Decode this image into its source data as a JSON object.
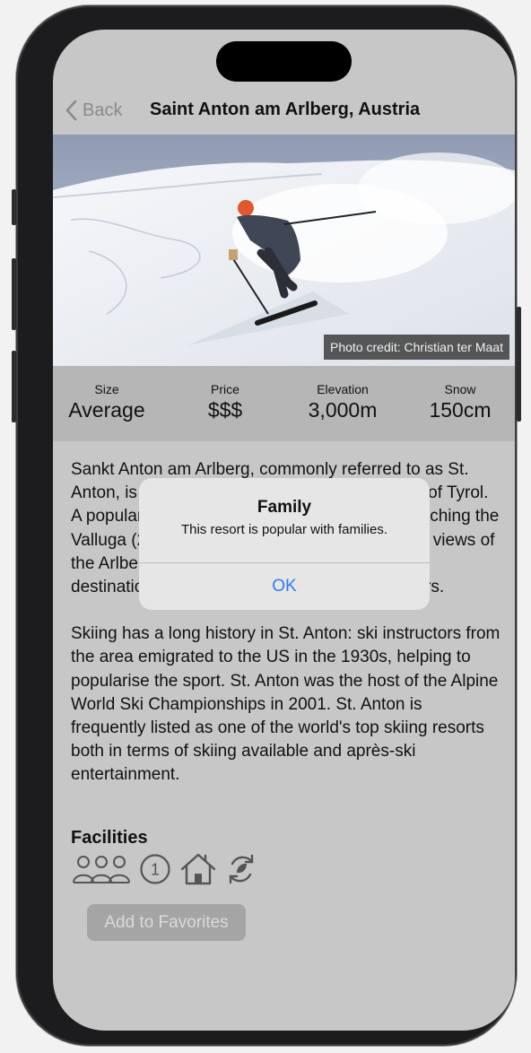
{
  "nav": {
    "back_label": "Back",
    "title": "Saint Anton am Arlberg, Austria"
  },
  "photo": {
    "credit": "Photo credit: Christian ter Maat"
  },
  "stats": [
    {
      "label": "Size",
      "value": "Average"
    },
    {
      "label": "Price",
      "value": "$$$"
    },
    {
      "label": "Elevation",
      "value": "3,000m"
    },
    {
      "label": "Snow",
      "value": "150cm"
    }
  ],
  "description": {
    "paragraph1": "Sankt Anton am Arlberg, commonly referred to as St. Anton, is a village in the western Austrian state of Tyrol. A popular winter resort with aerial tramways reaching the Valluga (2,811 m; 9,222 ft), yielding spectacular views of the Arlberg region. It is also a popular summer destination for hikers, trekkers and mountaineers.",
    "paragraph2": "Skiing has a long history in St. Anton: ski instructors from the area emigrated to the US in the 1930s, helping to popularise the sport. St. Anton was the host of the Alpine World Ski Championships in 2001. St. Anton is frequently listed as one of the world's top skiing resorts both in terms of skiing available and après-ski entertainment."
  },
  "facilities": {
    "title": "Facilities",
    "icons": [
      "family-icon",
      "one-circle-icon",
      "house-icon",
      "recycle-icon"
    ]
  },
  "favorites_button": "Add to Favorites",
  "alert": {
    "title": "Family",
    "message": "This resort is popular with families.",
    "ok_label": "OK"
  },
  "colors": {
    "accent": "#2e7cf6",
    "dimmed_background": "#c7c7c7",
    "stats_background": "#b6b6b6"
  }
}
